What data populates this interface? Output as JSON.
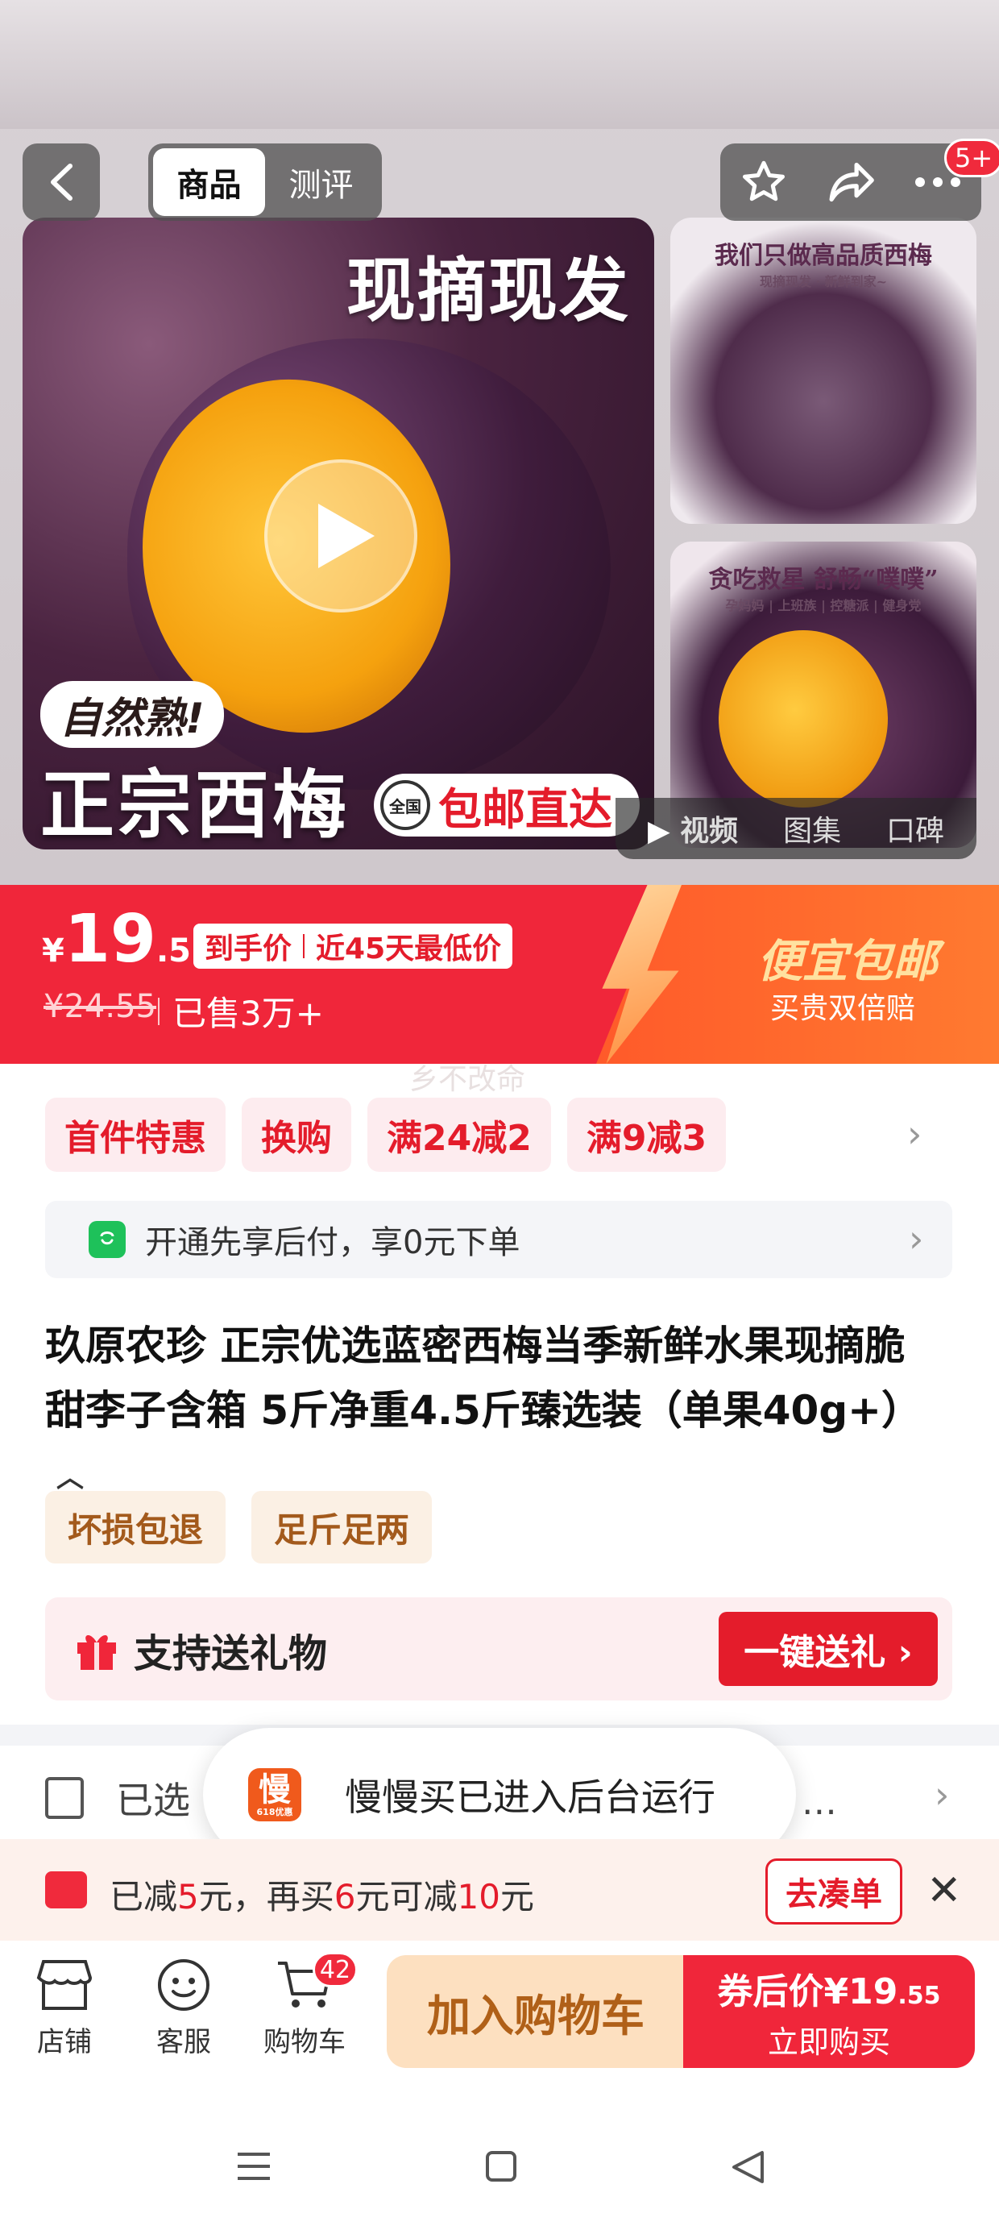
{
  "gallery": {
    "main_headline": "现摘现发",
    "natural_tag": "自然熟!",
    "product_name": "正宗西梅",
    "nationwide_badge": "全国",
    "free_shipping": "包邮直达",
    "side1_caption": "我们只做高品质西梅",
    "side1_sub": "现摘现发 · 新鲜到家~",
    "side2_caption": "贪吃救星 舒畅“噗噗”",
    "side2_sub": "孕妈妈 | 上班族 | 控糖派 | 健身党",
    "media_tabs": [
      "视频",
      "图集",
      "口碑"
    ]
  },
  "top_nav": {
    "tabs": [
      "商品",
      "测评"
    ],
    "badge": "5+"
  },
  "price": {
    "currency": "¥",
    "integer": "19",
    "decimal": ".55",
    "tag_left": "到手价",
    "tag_right": "近45天最低价",
    "original": "¥24.55",
    "sold": "已售3万+",
    "promo_title": "便宜包邮",
    "promo_sub": "买贵双倍赔"
  },
  "watermark": "乡不改命",
  "promos": [
    "首件特惠",
    "换购",
    "满24减2",
    "满9减3"
  ],
  "pay_later": "开通先享后付，享0元下单",
  "title": "玖原农珍 正宗优选蓝密西梅当季新鲜水果现摘脆甜李子含箱 5斤净重4.5斤臻选装（单果40g+）",
  "service_tags": [
    "坏损包退",
    "足斤足两"
  ],
  "gift": {
    "label": "支持送礼物",
    "button": "一键送礼 ›"
  },
  "selected": {
    "label": "已选",
    "more": "-）…"
  },
  "toast": {
    "icon_text": "慢",
    "icon_sub": "618优惠",
    "text": "慢慢买已进入后台运行"
  },
  "discount": {
    "p1": "已减",
    "v1": "5",
    "p2": "元，再买",
    "v2": "6",
    "p3": "元可减",
    "v3": "10",
    "p4": "元",
    "button": "去凑单"
  },
  "bottom": {
    "shop": "店铺",
    "service": "客服",
    "cart": "购物车",
    "cart_count": "42",
    "add_cart": "加入购物车",
    "coupon_price_label": "券后价",
    "coupon_price_int": "¥19",
    "coupon_price_dec": ".55",
    "buy_now": "立即购买"
  },
  "colors": {
    "brand_red": "#f0263a",
    "promo_orange": "#ff7a30",
    "cart_bg": "#fde0c0"
  }
}
